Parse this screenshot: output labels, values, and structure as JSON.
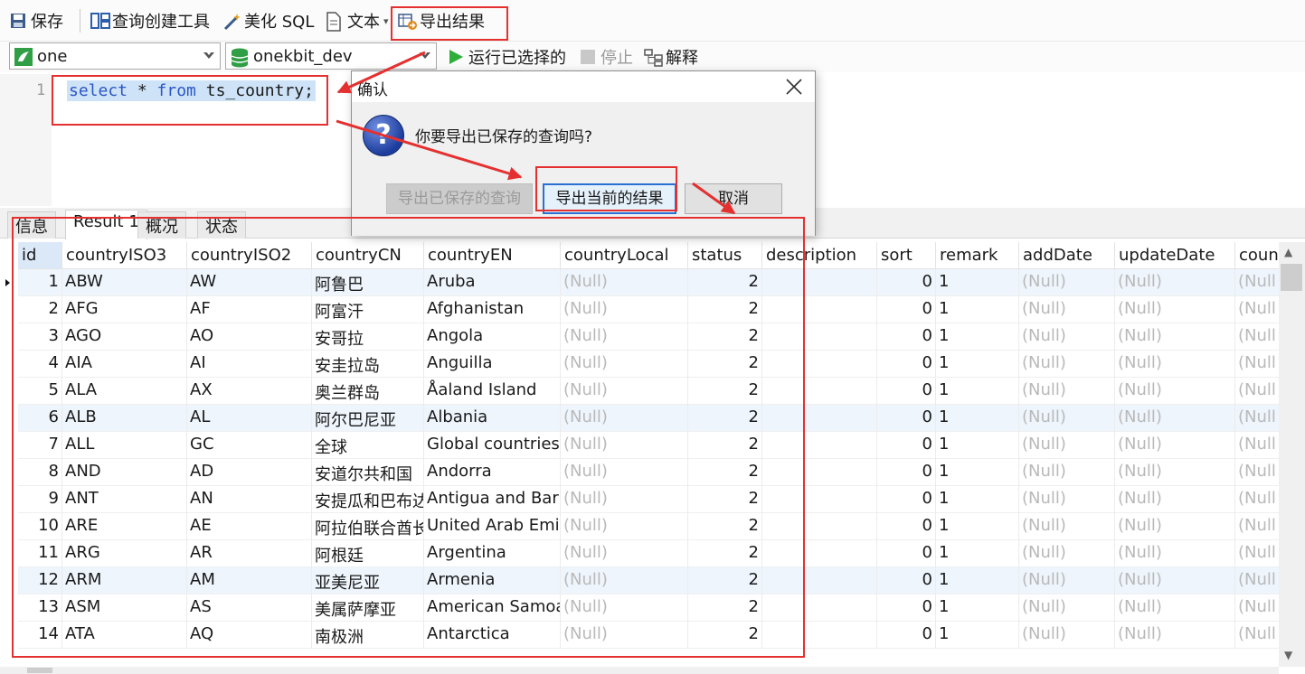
{
  "toolbar": {
    "save": "保存",
    "query_builder": "查询创建工具",
    "beautify_sql": "美化 SQL",
    "text": "文本",
    "export_result": "导出结果"
  },
  "selectors": {
    "connection": "one",
    "database": "onekbit_dev",
    "run_selected": "运行已选择的",
    "stop": "停止",
    "explain": "解释"
  },
  "editor": {
    "line_number": "1",
    "sql_kw1": "select",
    "sql_mid": " * ",
    "sql_kw2": "from",
    "sql_rest": " ts_country;"
  },
  "tabs": [
    "信息",
    "Result 1",
    "概况",
    "状态"
  ],
  "grid": {
    "columns": [
      "id",
      "countryISO3",
      "countryISO2",
      "countryCN",
      "countryEN",
      "countryLocal",
      "status",
      "description",
      "sort",
      "remark",
      "addDate",
      "updateDate",
      "coun"
    ],
    "rows": [
      [
        "1",
        "ABW",
        "AW",
        "阿鲁巴",
        "Aruba",
        "(Null)",
        "2",
        "",
        "0",
        "1",
        "(Null)",
        "(Null)",
        "(Null"
      ],
      [
        "2",
        "AFG",
        "AF",
        "阿富汗",
        "Afghanistan",
        "(Null)",
        "2",
        "",
        "0",
        "1",
        "(Null)",
        "(Null)",
        "(Null"
      ],
      [
        "3",
        "AGO",
        "AO",
        "安哥拉",
        "Angola",
        "(Null)",
        "2",
        "",
        "0",
        "1",
        "(Null)",
        "(Null)",
        "(Null"
      ],
      [
        "4",
        "AIA",
        "AI",
        "安圭拉岛",
        "Anguilla",
        "(Null)",
        "2",
        "",
        "0",
        "1",
        "(Null)",
        "(Null)",
        "(Null"
      ],
      [
        "5",
        "ALA",
        "AX",
        "奥兰群岛",
        "Åaland Island",
        "(Null)",
        "2",
        "",
        "0",
        "1",
        "(Null)",
        "(Null)",
        "(Null"
      ],
      [
        "6",
        "ALB",
        "AL",
        "阿尔巴尼亚",
        "Albania",
        "(Null)",
        "2",
        "",
        "0",
        "1",
        "(Null)",
        "(Null)",
        "(Null"
      ],
      [
        "7",
        "ALL",
        "GC",
        "全球",
        "Global countries",
        "(Null)",
        "2",
        "",
        "0",
        "1",
        "(Null)",
        "(Null)",
        "(Null"
      ],
      [
        "8",
        "AND",
        "AD",
        "安道尔共和国",
        "Andorra",
        "(Null)",
        "2",
        "",
        "0",
        "1",
        "(Null)",
        "(Null)",
        "(Null"
      ],
      [
        "9",
        "ANT",
        "AN",
        "安提瓜和巴布达",
        "Antigua and Barb",
        "(Null)",
        "2",
        "",
        "0",
        "1",
        "(Null)",
        "(Null)",
        "(Null"
      ],
      [
        "10",
        "ARE",
        "AE",
        "阿拉伯联合酋长",
        "United Arab Emir",
        "(Null)",
        "2",
        "",
        "0",
        "1",
        "(Null)",
        "(Null)",
        "(Null"
      ],
      [
        "11",
        "ARG",
        "AR",
        "阿根廷",
        "Argentina",
        "(Null)",
        "2",
        "",
        "0",
        "1",
        "(Null)",
        "(Null)",
        "(Null"
      ],
      [
        "12",
        "ARM",
        "AM",
        "亚美尼亚",
        "Armenia",
        "(Null)",
        "2",
        "",
        "0",
        "1",
        "(Null)",
        "(Null)",
        "(Null"
      ],
      [
        "13",
        "ASM",
        "AS",
        "美属萨摩亚",
        "American Samoa",
        "(Null)",
        "2",
        "",
        "0",
        "1",
        "(Null)",
        "(Null)",
        "(Null"
      ],
      [
        "14",
        "ATA",
        "AQ",
        "南极洲",
        "Antarctica",
        "(Null)",
        "2",
        "",
        "0",
        "1",
        "(Null)",
        "(Null)",
        "(Null"
      ]
    ]
  },
  "dialog": {
    "title": "确认",
    "message": "你要导出已保存的查询吗?",
    "btn_saved": "导出已保存的查询",
    "btn_current": "导出当前的结果",
    "btn_cancel": "取消"
  },
  "colors": {
    "annotation": "#e53030",
    "selection": "#cfe3f8",
    "keyword": "#2a56c6",
    "null_text": "#b9b9b9",
    "row_highlight": "#eef5fc"
  }
}
